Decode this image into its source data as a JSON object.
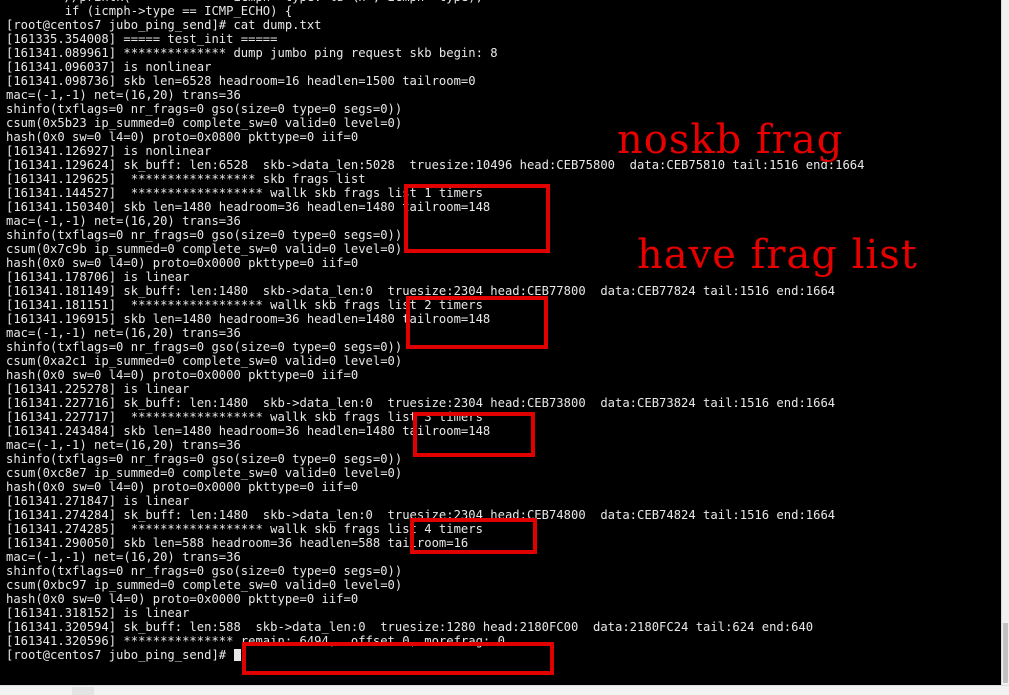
{
  "terminal": {
    "lines": [
      "        //printk(\"************ icmph->type: %d \\n\", icmph->type);",
      "        if (icmph->type == ICMP_ECHO) {",
      "[root@centos7 jubo_ping_send]# cat dump.txt",
      "[161335.354008] ===== test_init =====",
      "[161341.089961] ************** dump jumbo ping request skb begin: 8",
      "[161341.096037] is nonlinear",
      "[161341.098736] skb len=6528 headroom=16 headlen=1500 tailroom=0",
      "mac=(-1,-1) net=(16,20) trans=36",
      "shinfo(txflags=0 nr_frags=0 gso(size=0 type=0 segs=0))",
      "csum(0x5b23 ip_summed=0 complete_sw=0 valid=0 level=0)",
      "hash(0x0 sw=0 l4=0) proto=0x0800 pkttype=0 iif=0",
      "[161341.126927] is nonlinear",
      "[161341.129624] sk_buff: len:6528  skb->data_len:5028  truesize:10496 head:CEB75800  data:CEB75810 tail:1516 end:1664",
      "[161341.129625]  ***************** skb frags list",
      "[161341.144527]  ****************** wallk skb frags list 1 timers",
      "[161341.150340] skb len=1480 headroom=36 headlen=1480 tailroom=148",
      "mac=(-1,-1) net=(16,20) trans=36",
      "shinfo(txflags=0 nr_frags=0 gso(size=0 type=0 segs=0))",
      "csum(0x7c9b ip_summed=0 complete_sw=0 valid=0 level=0)",
      "hash(0x0 sw=0 l4=0) proto=0x0000 pkttype=0 iif=0",
      "[161341.178706] is linear",
      "[161341.181149] sk_buff: len:1480  skb->data_len:0  truesize:2304 head:CEB77800  data:CEB77824 tail:1516 end:1664",
      "[161341.181151]  ****************** wallk skb frags list 2 timers",
      "[161341.196915] skb len=1480 headroom=36 headlen=1480 tailroom=148",
      "mac=(-1,-1) net=(16,20) trans=36",
      "shinfo(txflags=0 nr_frags=0 gso(size=0 type=0 segs=0))",
      "csum(0xa2c1 ip_summed=0 complete_sw=0 valid=0 level=0)",
      "hash(0x0 sw=0 l4=0) proto=0x0000 pkttype=0 iif=0",
      "[161341.225278] is linear",
      "[161341.227716] sk_buff: len:1480  skb->data_len:0  truesize:2304 head:CEB73800  data:CEB73824 tail:1516 end:1664",
      "[161341.227717]  ****************** wallk skb frags list 3 timers",
      "[161341.243484] skb len=1480 headroom=36 headlen=1480 tailroom=148",
      "mac=(-1,-1) net=(16,20) trans=36",
      "shinfo(txflags=0 nr_frags=0 gso(size=0 type=0 segs=0))",
      "csum(0xc8e7 ip_summed=0 complete_sw=0 valid=0 level=0)",
      "hash(0x0 sw=0 l4=0) proto=0x0000 pkttype=0 iif=0",
      "[161341.271847] is linear",
      "[161341.274284] sk_buff: len:1480  skb->data_len:0  truesize:2304 head:CEB74800  data:CEB74824 tail:1516 end:1664",
      "[161341.274285]  ****************** wallk skb frags list 4 timers",
      "[161341.290050] skb len=588 headroom=36 headlen=588 tailroom=16",
      "mac=(-1,-1) net=(16,20) trans=36",
      "shinfo(txflags=0 nr_frags=0 gso(size=0 type=0 segs=0))",
      "csum(0xbc97 ip_summed=0 complete_sw=0 valid=0 level=0)",
      "hash(0x0 sw=0 l4=0) proto=0x0000 pkttype=0 iif=0",
      "[161341.318152] is linear",
      "[161341.320594] sk_buff: len:588  skb->data_len:0  truesize:1280 head:2180FC00  data:2180FC24 tail:624 end:640",
      "[161341.320596] *************** remain: 6494,  offset 0, morefrag: 0",
      "[root@centos7 jubo_ping_send]# "
    ]
  },
  "annotations": {
    "noskb_frag": "noskb frag",
    "have_frag_list": "have frag list"
  },
  "colors": {
    "terminal_bg": "#000000",
    "terminal_fg": "#e8e8e8",
    "highlight": "#e00000"
  }
}
